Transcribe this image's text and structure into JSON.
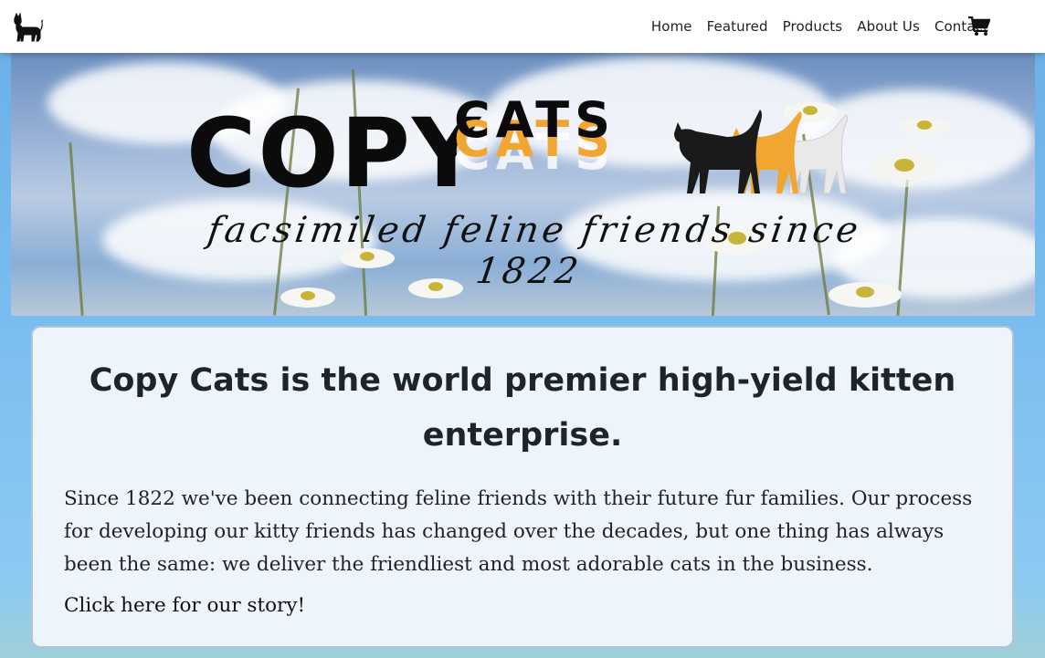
{
  "nav": {
    "brand_icon": "cat-icon",
    "links": [
      "Home",
      "Featured",
      "Products",
      "About Us",
      "Contact"
    ],
    "cart_icon": "shopping-cart-icon"
  },
  "hero": {
    "logo_word_1": "COPY",
    "logo_word_2": "CATS",
    "tagline": "facsimiled feline friends since 1822",
    "colors": {
      "cat_black": "#1a1a1a",
      "cat_orange": "#f2a632",
      "cat_white": "#e9e9e9"
    }
  },
  "intro": {
    "title": "Copy Cats is the world premier high-yield kitten enterprise.",
    "body": "Since 1822 we've been connecting feline friends with their future fur families. Our process for developing our kitty friends has changed over the decades, but one thing has always been the same: we deliver the friendliest and most adorable cats in the business.",
    "link": "Click here for our story!"
  }
}
